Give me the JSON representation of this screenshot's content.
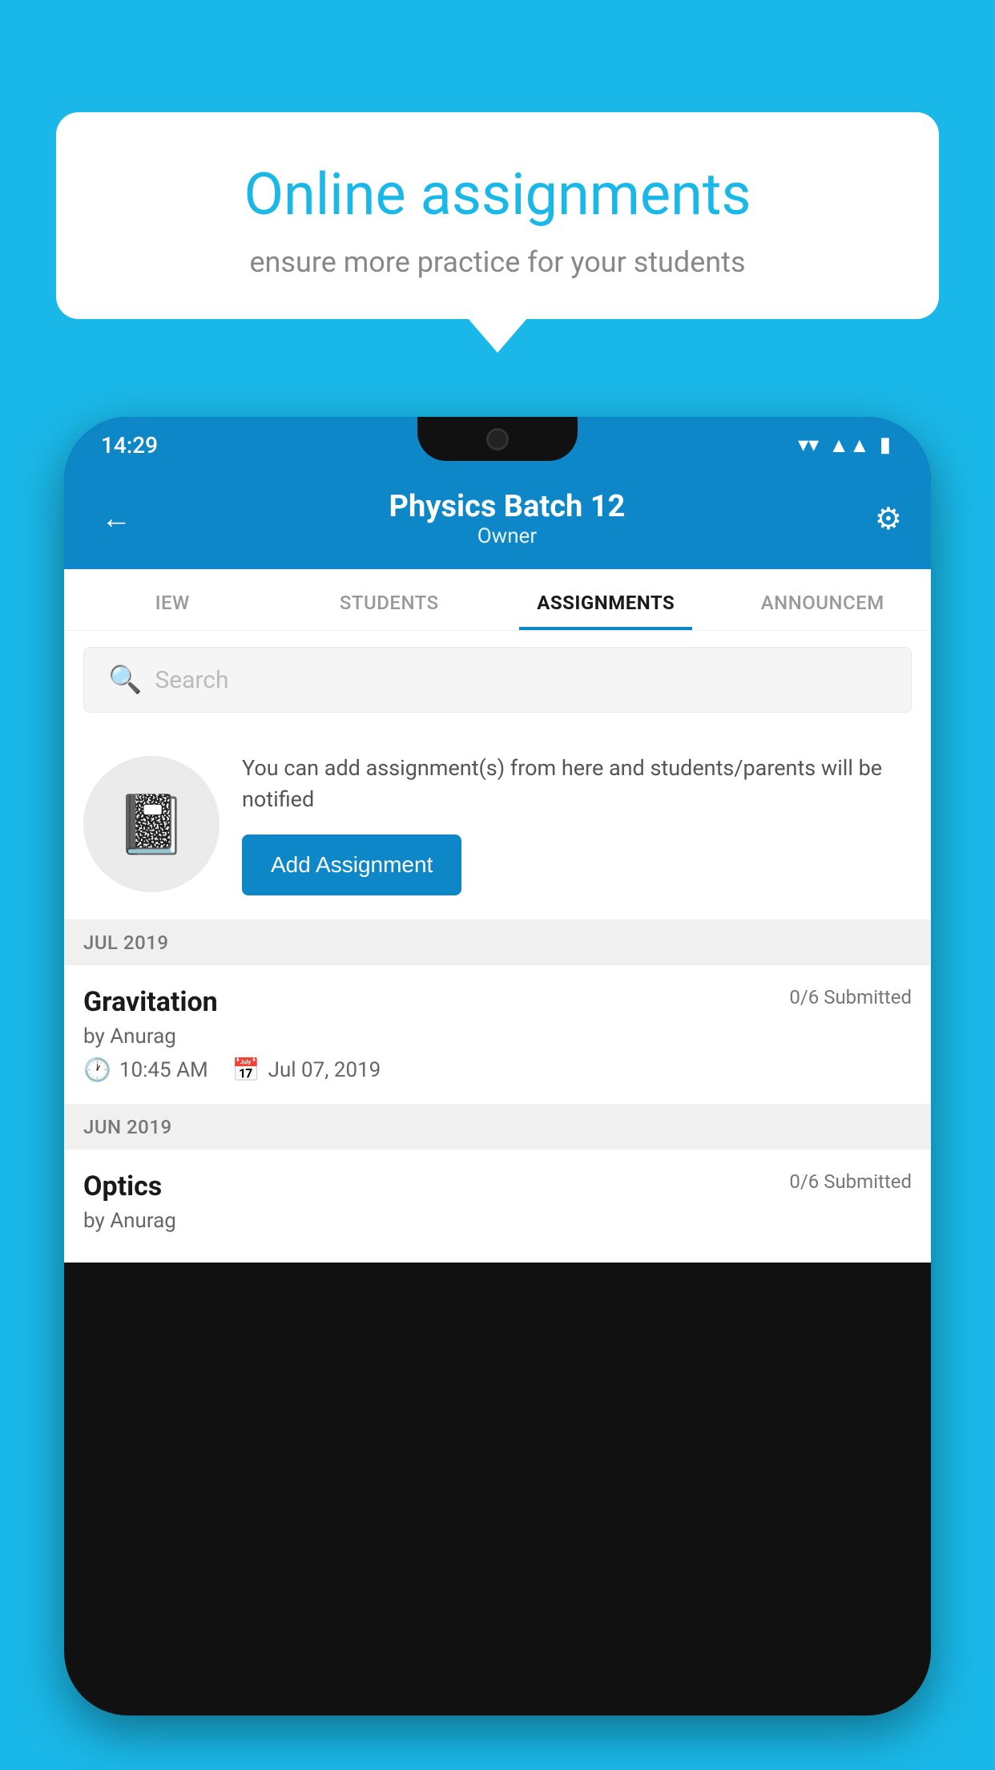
{
  "background_color": "#1ab8e8",
  "promo": {
    "title": "Online assignments",
    "subtitle": "ensure more practice for your students"
  },
  "status_bar": {
    "time": "14:29",
    "wifi_icon": "▼",
    "signal_icon": "▲",
    "battery_icon": "🔋"
  },
  "header": {
    "title": "Physics Batch 12",
    "subtitle": "Owner",
    "back_icon": "←",
    "settings_icon": "⚙"
  },
  "tabs": [
    {
      "label": "IEW",
      "active": false
    },
    {
      "label": "STUDENTS",
      "active": false
    },
    {
      "label": "ASSIGNMENTS",
      "active": true
    },
    {
      "label": "ANNOUNCEM",
      "active": false
    }
  ],
  "search": {
    "placeholder": "Search"
  },
  "assignment_promo": {
    "description": "You can add assignment(s) from here and students/parents will be notified",
    "button_label": "Add Assignment"
  },
  "sections": [
    {
      "month": "JUL 2019",
      "assignments": [
        {
          "name": "Gravitation",
          "submitted": "0/6 Submitted",
          "by": "by Anurag",
          "time": "10:45 AM",
          "date": "Jul 07, 2019"
        }
      ]
    },
    {
      "month": "JUN 2019",
      "assignments": [
        {
          "name": "Optics",
          "submitted": "0/6 Submitted",
          "by": "by Anurag",
          "time": "",
          "date": ""
        }
      ]
    }
  ]
}
